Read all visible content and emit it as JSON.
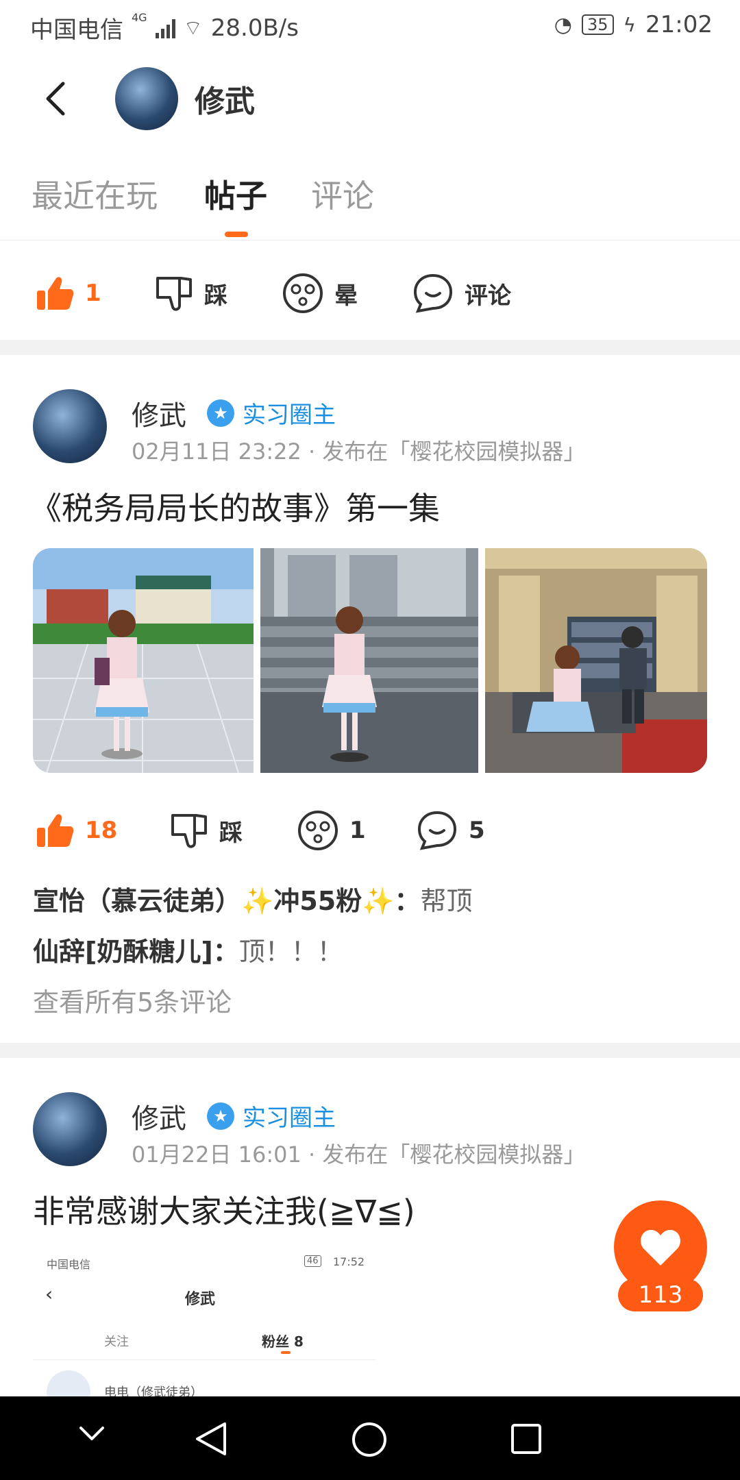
{
  "status_bar": {
    "carrier": "中国电信",
    "network": "4G",
    "speed": "28.0B/s",
    "battery": "35",
    "time": "21:02"
  },
  "header": {
    "user_name": "修武"
  },
  "tabs": [
    {
      "label": "最近在玩",
      "active": false
    },
    {
      "label": "帖子",
      "active": true
    },
    {
      "label": "评论",
      "active": false
    }
  ],
  "top_actions": {
    "like_count": "1",
    "dislike_label": "踩",
    "dizzy_label": "晕",
    "comment_label": "评论"
  },
  "posts": [
    {
      "author": "修武",
      "badge": "实习圈主",
      "meta": "02月11日 23:22 · 发布在「樱花校园模拟器」",
      "title": "《税务局局长的故事》第一集",
      "actions": {
        "like_count": "18",
        "dislike_label": "踩",
        "dizzy_count": "1",
        "comment_count": "5"
      },
      "comments": [
        {
          "user": "宣怡（慕云徒弟）✨冲55粉✨：",
          "text": "帮顶"
        },
        {
          "user": "仙辞[奶酥糖儿]：",
          "text": "顶！！！"
        }
      ],
      "view_all": "查看所有5条评论"
    },
    {
      "author": "修武",
      "badge": "实习圈主",
      "meta": "01月22日 16:01 · 发布在「樱花校园模拟器」",
      "title": "非常感谢大家关注我(≧∇≦)",
      "screenshot": {
        "carrier": "中国电信",
        "time": "17:52",
        "battery": "46",
        "name": "修武",
        "tab_follow": "关注",
        "tab_fans": "粉丝 8",
        "row_text": "电电（修武徒弟）"
      }
    }
  ],
  "fab": {
    "count": "113"
  },
  "colors": {
    "accent": "#ff6a1a",
    "badge_blue": "#1a8fe0"
  }
}
